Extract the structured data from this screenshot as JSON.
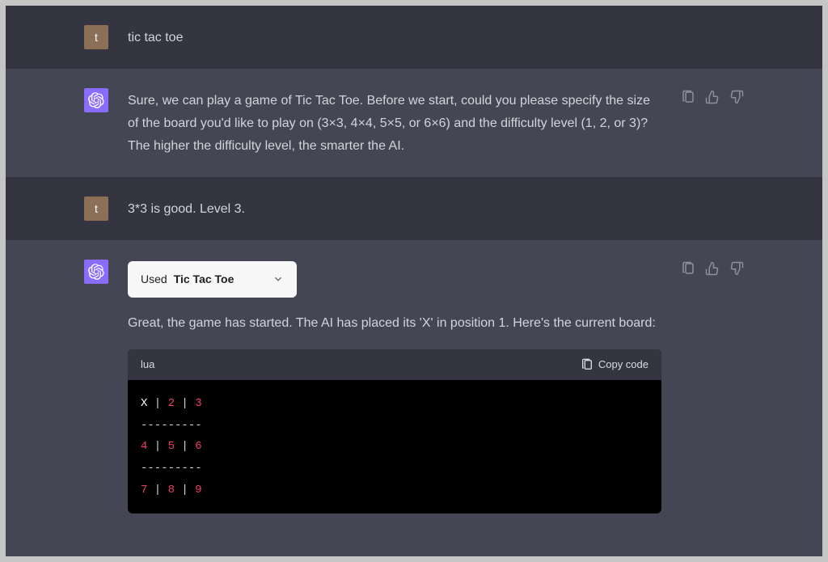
{
  "messages": {
    "user1": {
      "avatar_letter": "t",
      "text": "tic tac toe"
    },
    "assistant1": {
      "text": "Sure, we can play a game of Tic Tac Toe. Before we start, could you please specify the size of the board you'd like to play on (3×3, 4×4, 5×5, or 6×6) and the difficulty level (1, 2, or 3)? The higher the difficulty level, the smarter the AI."
    },
    "user2": {
      "avatar_letter": "t",
      "text": "3*3 is good. Level 3."
    },
    "assistant2": {
      "plugin_prefix": "Used ",
      "plugin_name": "Tic Tac Toe",
      "text": "Great, the game has started. The AI has placed its 'X' in position 1. Here's the current board:",
      "code": {
        "language": "lua",
        "copy_label": "Copy code",
        "board": {
          "row1": {
            "a": "X",
            "b": "2",
            "c": "3"
          },
          "sep": "---------",
          "row2": {
            "a": "4",
            "b": "5",
            "c": "6"
          },
          "row3": {
            "a": "7",
            "b": "8",
            "c": "9"
          },
          "pipe": " | "
        }
      }
    }
  }
}
